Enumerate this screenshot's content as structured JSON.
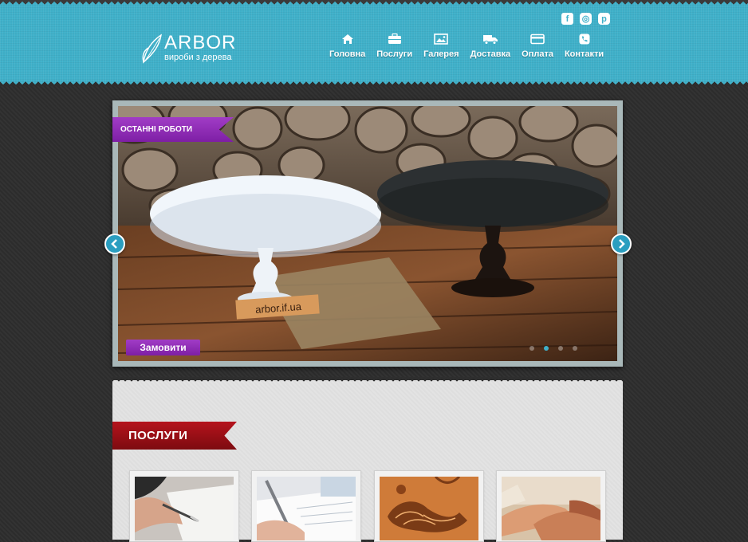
{
  "header": {
    "logo": {
      "brand": "ARBOR",
      "tagline": "вироби з дерева"
    },
    "social": [
      {
        "icon": "facebook-icon",
        "glyph": "f"
      },
      {
        "icon": "instagram-icon",
        "glyph": "◎"
      },
      {
        "icon": "pinterest-icon",
        "glyph": "p"
      }
    ],
    "nav": [
      {
        "icon": "home-icon",
        "label": "Головна"
      },
      {
        "icon": "briefcase-icon",
        "label": "Послуги"
      },
      {
        "icon": "image-icon",
        "label": "Галерея"
      },
      {
        "icon": "truck-icon",
        "label": "Доставка"
      },
      {
        "icon": "credit-card-icon",
        "label": "Оплата"
      },
      {
        "icon": "phone-icon",
        "label": "Контакти"
      }
    ]
  },
  "slider": {
    "ribbon": "ОСТАННІ РОБОТИ",
    "watermark": "arbor.if.ua",
    "order_label": "Замовити",
    "slide_count": 4,
    "active_slide": 2
  },
  "services": {
    "title": "ПОСЛУГИ",
    "cards": [
      {
        "image": "signing-document-photo"
      },
      {
        "image": "writing-pen-photo"
      },
      {
        "image": "wood-carving-photo"
      },
      {
        "image": "handshake-photo"
      }
    ]
  },
  "colors": {
    "header": "#3fb0c9",
    "accent_purple": "#8b2bb3",
    "accent_red": "#a8141b",
    "background": "#2e2e2e"
  }
}
